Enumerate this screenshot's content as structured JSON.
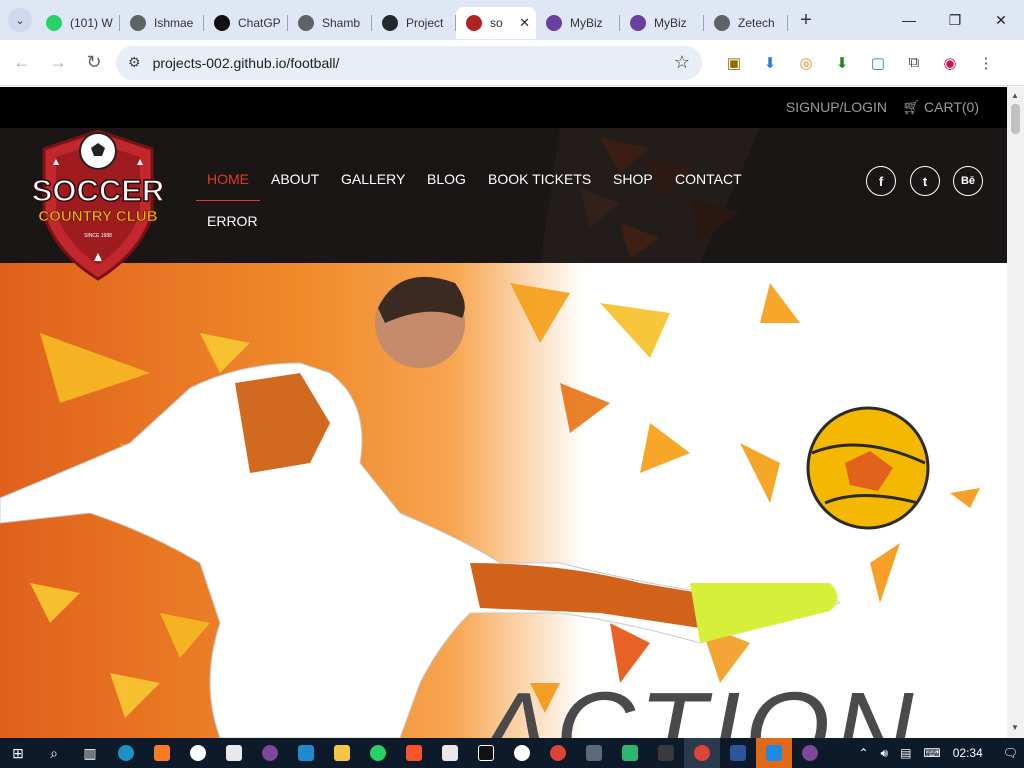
{
  "browser": {
    "tabs": [
      {
        "title": "(101) W",
        "icon": "whatsapp-icon",
        "color": "#25d366"
      },
      {
        "title": "Ishmae",
        "icon": "globe-icon",
        "color": "#5f6368"
      },
      {
        "title": "ChatGP",
        "icon": "openai-icon",
        "color": "#111111"
      },
      {
        "title": "Shamb",
        "icon": "globe-icon",
        "color": "#5f6368"
      },
      {
        "title": "Project",
        "icon": "github-icon",
        "color": "#24292e"
      },
      {
        "title": "so",
        "icon": "soccer-club-icon",
        "color": "#b22222",
        "active": true
      },
      {
        "title": "MyBiz",
        "icon": "mybiz-icon",
        "color": "#6b3fa0"
      },
      {
        "title": "MyBiz",
        "icon": "mybiz-icon",
        "color": "#6b3fa0"
      },
      {
        "title": "Zetech",
        "icon": "globe-icon",
        "color": "#5f6368"
      }
    ],
    "url": "projects-002.github.io/football/"
  },
  "site": {
    "signup": "SIGNUP/LOGIN",
    "cart": "CART(0)",
    "nav": [
      "HOME",
      "ABOUT",
      "GALLERY",
      "BLOG",
      "BOOK TICKETS",
      "SHOP",
      "CONTACT",
      "ERROR"
    ],
    "social": [
      "f",
      "t",
      "Bē"
    ],
    "logo": {
      "line1": "SOCCER",
      "line2": "COUNTRY CLUB",
      "since": "SINCE 1988"
    },
    "hero_word": "ACTION",
    "colors": {
      "accent": "#e03a2a",
      "hero_orange": "#ef7a22",
      "header_bg": "#1a1615"
    }
  },
  "taskbar": {
    "time": "02:34"
  }
}
